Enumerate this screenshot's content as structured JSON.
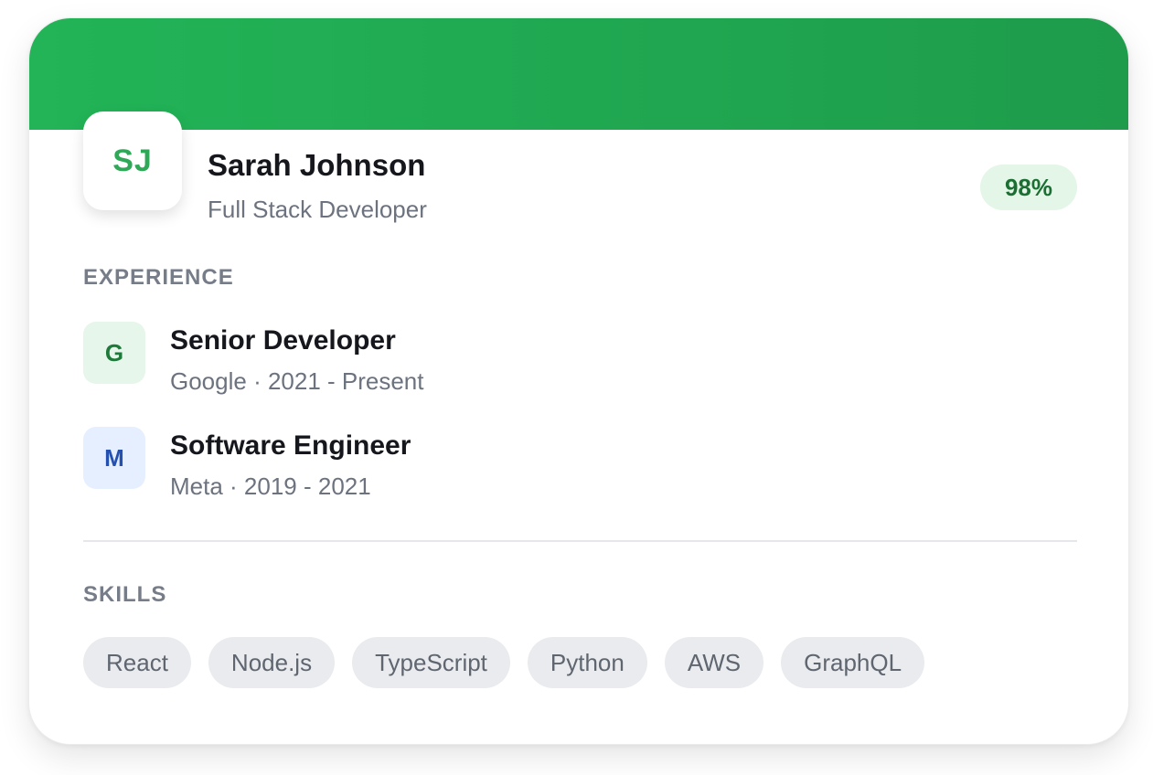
{
  "profile": {
    "initials": "SJ",
    "name": "Sarah Johnson",
    "role": "Full Stack Developer",
    "match": "98%"
  },
  "experience": {
    "heading": "EXPERIENCE",
    "items": [
      {
        "logo": "G",
        "title": "Senior Developer",
        "meta": "Google · 2021 - Present",
        "logo_bg": "#e6f6ea",
        "logo_color": "#1e7a3a"
      },
      {
        "logo": "M",
        "title": "Software Engineer",
        "meta": "Meta · 2019 - 2021",
        "logo_bg": "#e5efff",
        "logo_color": "#2450b0"
      }
    ]
  },
  "skills": {
    "heading": "SKILLS",
    "items": [
      "React",
      "Node.js",
      "TypeScript",
      "Python",
      "AWS",
      "GraphQL"
    ]
  },
  "colors": {
    "banner": "#22b457",
    "accent": "#2fa858",
    "badge_bg": "#e3f6e7",
    "badge_text": "#1b6f33"
  }
}
